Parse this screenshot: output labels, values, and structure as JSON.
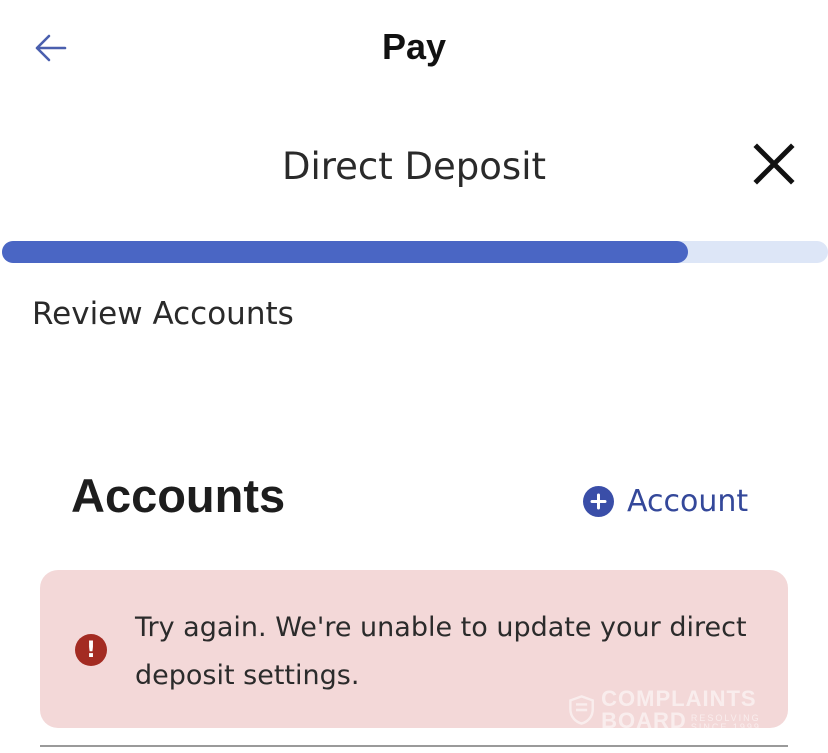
{
  "header": {
    "back_icon": "arrow-left-icon",
    "title": "Pay",
    "accent_color": "#4a66c4"
  },
  "subheader": {
    "title": "Direct Deposit",
    "close_icon": "close-icon"
  },
  "progress": {
    "fraction": 0.83,
    "fill_color": "#4a66c4",
    "track_color": "#dde6f7"
  },
  "step": {
    "label": "Review Accounts"
  },
  "accounts": {
    "title": "Accounts",
    "add_label": "Account",
    "add_icon": "plus-circle-icon"
  },
  "error": {
    "icon": "exclamation-circle-icon",
    "message": "Try again. We're unable to update your direct deposit settings.",
    "background_color": "#f3d8d8",
    "icon_color": "#a32b22"
  },
  "watermark": {
    "line1": "COMPLAINTS",
    "line2": "BOARD",
    "tagline": "RESOLVING SINCE 1999"
  }
}
